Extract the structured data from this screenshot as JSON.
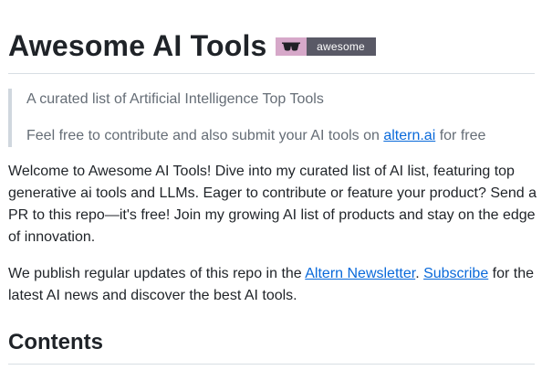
{
  "header": {
    "title": "Awesome AI Tools",
    "badge": {
      "icon": "sunglasses-icon",
      "label": "awesome",
      "left_color": "#d6a8c9",
      "right_color": "#595966"
    }
  },
  "intro_quote": {
    "line1": "A curated list of Artificial Intelligence Top Tools",
    "line2_before": "Feel free to contribute and also submit your AI tools on ",
    "line2_link": "altern.ai",
    "line2_after": " for free"
  },
  "welcome_paragraph": "Welcome to Awesome AI Tools! Dive into my curated list of AI list, featuring top generative ai tools and LLMs. Eager to contribute or feature your product? Send a PR to this repo—it's free! Join my growing AI list of products and stay on the edge of innovation.",
  "updates_paragraph": {
    "before": "We publish regular updates of this repo in the ",
    "link1": "Altern Newsletter",
    "between": ". ",
    "link2": "Subscribe",
    "after": " for the latest AI news and discover the best AI tools."
  },
  "contents_heading": "Contents",
  "colors": {
    "text": "#1f2328",
    "muted": "#656d76",
    "link": "#0969da"
  }
}
